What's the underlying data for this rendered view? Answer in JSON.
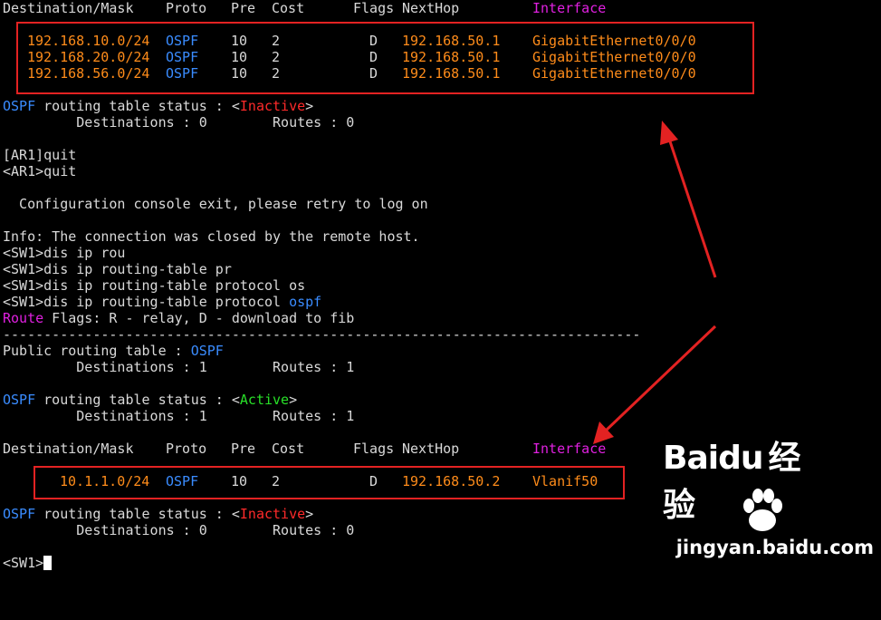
{
  "table1": {
    "header": {
      "dest": "Destination/Mask",
      "proto": "Proto",
      "pre": "Pre",
      "cost": "Cost",
      "flags": "Flags",
      "nexthop": "NextHop",
      "interface": "Interface"
    },
    "rows": [
      {
        "dest": "192.168.10.0/24",
        "proto": "OSPF",
        "pre": "10",
        "cost": "2",
        "flags": "D",
        "nexthop": "192.168.50.1",
        "iface": "GigabitEthernet0/0/0"
      },
      {
        "dest": "192.168.20.0/24",
        "proto": "OSPF",
        "pre": "10",
        "cost": "2",
        "flags": "D",
        "nexthop": "192.168.50.1",
        "iface": "GigabitEthernet0/0/0"
      },
      {
        "dest": "192.168.56.0/24",
        "proto": "OSPF",
        "pre": "10",
        "cost": "2",
        "flags": "D",
        "nexthop": "192.168.50.1",
        "iface": "GigabitEthernet0/0/0"
      }
    ]
  },
  "status1": {
    "proto": "OSPF",
    "text": " routing table status : ",
    "lt": "<",
    "state": "Inactive",
    "gt": ">",
    "dest_line": "         Destinations : 0        Routes : 0"
  },
  "console": {
    "l1": "[AR1]quit",
    "l2": "<AR1>quit",
    "l3": "  Configuration console exit, please retry to log on",
    "l4": "Info: The connection was closed by the remote host.",
    "l5": "<SW1>dis ip rou",
    "l6": "<SW1>dis ip routing-table pr",
    "l7": "<SW1>dis ip routing-table protocol os",
    "l8_prefix": "<SW1>dis ip routing-table protocol ",
    "l8_kw": "ospf"
  },
  "flags_line": {
    "route": "Route",
    "rest": " Flags: R - relay, D - download to fib"
  },
  "separator": "------------------------------------------------------------------------------",
  "public": {
    "prefix": "Public routing table : ",
    "proto": "OSPF",
    "dest_line": "         Destinations : 1        Routes : 1"
  },
  "status2": {
    "proto": "OSPF",
    "text": " routing table status : ",
    "lt": "<",
    "state": "Active",
    "gt": ">",
    "dest_line": "         Destinations : 1        Routes : 1"
  },
  "table2": {
    "header": {
      "dest": "Destination/Mask",
      "proto": "Proto",
      "pre": "Pre",
      "cost": "Cost",
      "flags": "Flags",
      "nexthop": "NextHop",
      "interface": "Interface"
    },
    "rows": [
      {
        "dest": "10.1.1.0/24",
        "proto": "OSPF",
        "pre": "10",
        "cost": "2",
        "flags": "D",
        "nexthop": "192.168.50.2",
        "iface": "Vlanif50"
      }
    ]
  },
  "status3": {
    "proto": "OSPF",
    "text": " routing table status : ",
    "lt": "<",
    "state": "Inactive",
    "gt": ">",
    "dest_line": "         Destinations : 0        Routes : 0"
  },
  "prompt": "<SW1>",
  "watermark": {
    "brand": "Bai",
    "brand2": "du",
    "cn": "经验",
    "url": "jingyan.baidu.com"
  },
  "colors": {
    "highlight_box": "#e32222",
    "ospf": "#3a8cff",
    "inactive": "#ff2a2a",
    "active": "#28e028",
    "interface_header": "#e020e0",
    "route_values": "#ff8c1a"
  }
}
